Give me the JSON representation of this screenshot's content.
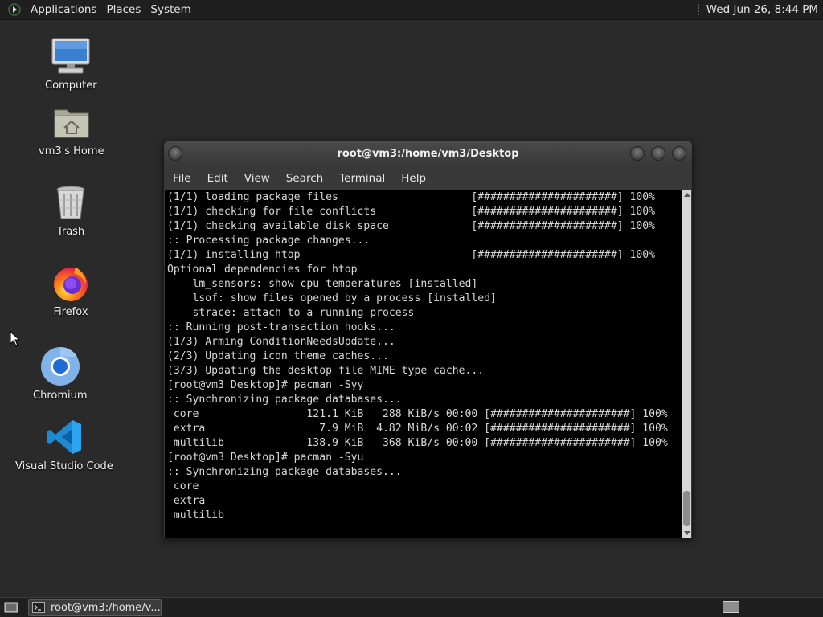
{
  "top_panel": {
    "menus": [
      "Applications",
      "Places",
      "System"
    ],
    "clock": "Wed Jun 26,  8:44 PM"
  },
  "desktop_icons": [
    {
      "label": "Computer",
      "icon": "computer-icon"
    },
    {
      "label": "vm3's Home",
      "icon": "home-folder-icon"
    },
    {
      "label": "Trash",
      "icon": "trash-icon"
    },
    {
      "label": "Firefox",
      "icon": "firefox-icon"
    },
    {
      "label": "Chromium",
      "icon": "chromium-icon"
    },
    {
      "label": "Visual Studio Code",
      "icon": "vscode-icon"
    }
  ],
  "terminal": {
    "title": "root@vm3:/home/vm3/Desktop",
    "menu": [
      "File",
      "Edit",
      "View",
      "Search",
      "Terminal",
      "Help"
    ],
    "output": "(1/1) loading package files                     [######################] 100%\n(1/1) checking for file conflicts               [######################] 100%\n(1/1) checking available disk space             [######################] 100%\n:: Processing package changes...\n(1/1) installing htop                           [######################] 100%\nOptional dependencies for htop\n    lm_sensors: show cpu temperatures [installed]\n    lsof: show files opened by a process [installed]\n    strace: attach to a running process\n:: Running post-transaction hooks...\n(1/3) Arming ConditionNeedsUpdate...\n(2/3) Updating icon theme caches...\n(3/3) Updating the desktop file MIME type cache...\n[root@vm3 Desktop]# pacman -Syy\n:: Synchronizing package databases...\n core                 121.1 KiB   288 KiB/s 00:00 [######################] 100%\n extra                  7.9 MiB  4.82 MiB/s 00:02 [######################] 100%\n multilib             138.9 KiB   368 KiB/s 00:00 [######################] 100%\n[root@vm3 Desktop]# pacman -Syu\n:: Synchronizing package databases...\n core\n extra\n multilib"
  },
  "taskbar": {
    "task_label": "root@vm3:/home/v..."
  }
}
